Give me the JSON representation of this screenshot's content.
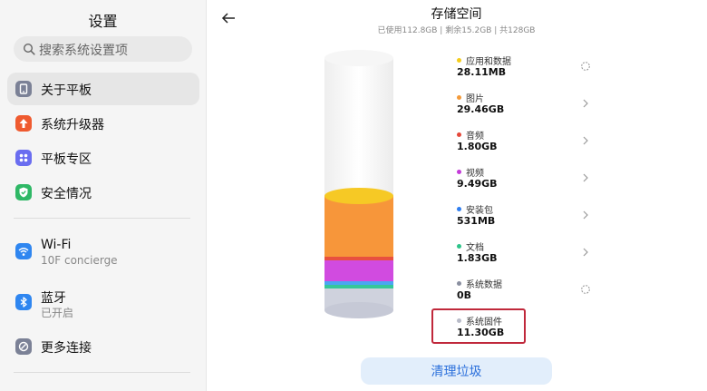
{
  "sidebar": {
    "title": "设置",
    "search_placeholder": "搜索系统设置项",
    "items": [
      {
        "label": "关于平板",
        "icon": "tablet-icon",
        "color": "#7b8196"
      },
      {
        "label": "系统升级器",
        "icon": "upgrade-arrow-icon",
        "color": "#ef5a2f"
      },
      {
        "label": "平板专区",
        "icon": "apps-grid-icon",
        "color": "#6a6df0"
      },
      {
        "label": "安全情况",
        "icon": "shield-check-icon",
        "color": "#2fb866"
      },
      {
        "label": "Wi-Fi",
        "sublabel": "10F concierge",
        "icon": "wifi-icon",
        "color": "#2f86f0"
      },
      {
        "label": "蓝牙",
        "sublabel": "已开启",
        "icon": "bluetooth-icon",
        "color": "#2f86f0"
      },
      {
        "label": "更多连接",
        "icon": "link-icon",
        "color": "#7b8196"
      }
    ]
  },
  "header": {
    "title": "存储空间",
    "subtitle": "已使用112.8GB | 剩余15.2GB | 共128GB"
  },
  "storage": {
    "used_gb": 112.8,
    "free_gb": 15.2,
    "total_gb": 128,
    "categories": [
      {
        "name": "应用和数据",
        "size": "28.11MB",
        "color": "#f4cc1c",
        "action": "loading"
      },
      {
        "name": "图片",
        "size": "29.46GB",
        "color": "#f49a3a",
        "action": "chevron"
      },
      {
        "name": "音频",
        "size": "1.80GB",
        "color": "#e5483a",
        "action": "chevron"
      },
      {
        "name": "视频",
        "size": "9.49GB",
        "color": "#c43bd9",
        "action": "chevron"
      },
      {
        "name": "安装包",
        "size": "531MB",
        "color": "#2f7ef0",
        "action": "chevron"
      },
      {
        "name": "文档",
        "size": "1.83GB",
        "color": "#2ec48a",
        "action": "chevron"
      },
      {
        "name": "系统数据",
        "size": "0B",
        "color": "#8a8fa0",
        "action": "loading"
      },
      {
        "name": "系统固件",
        "size": "11.30GB",
        "color": "#b8bbc8",
        "action": "none"
      }
    ]
  },
  "actions": {
    "clean_label": "清理垃圾"
  },
  "colors": {
    "accent": "#2a6fdb",
    "highlight": "#c0283b"
  }
}
